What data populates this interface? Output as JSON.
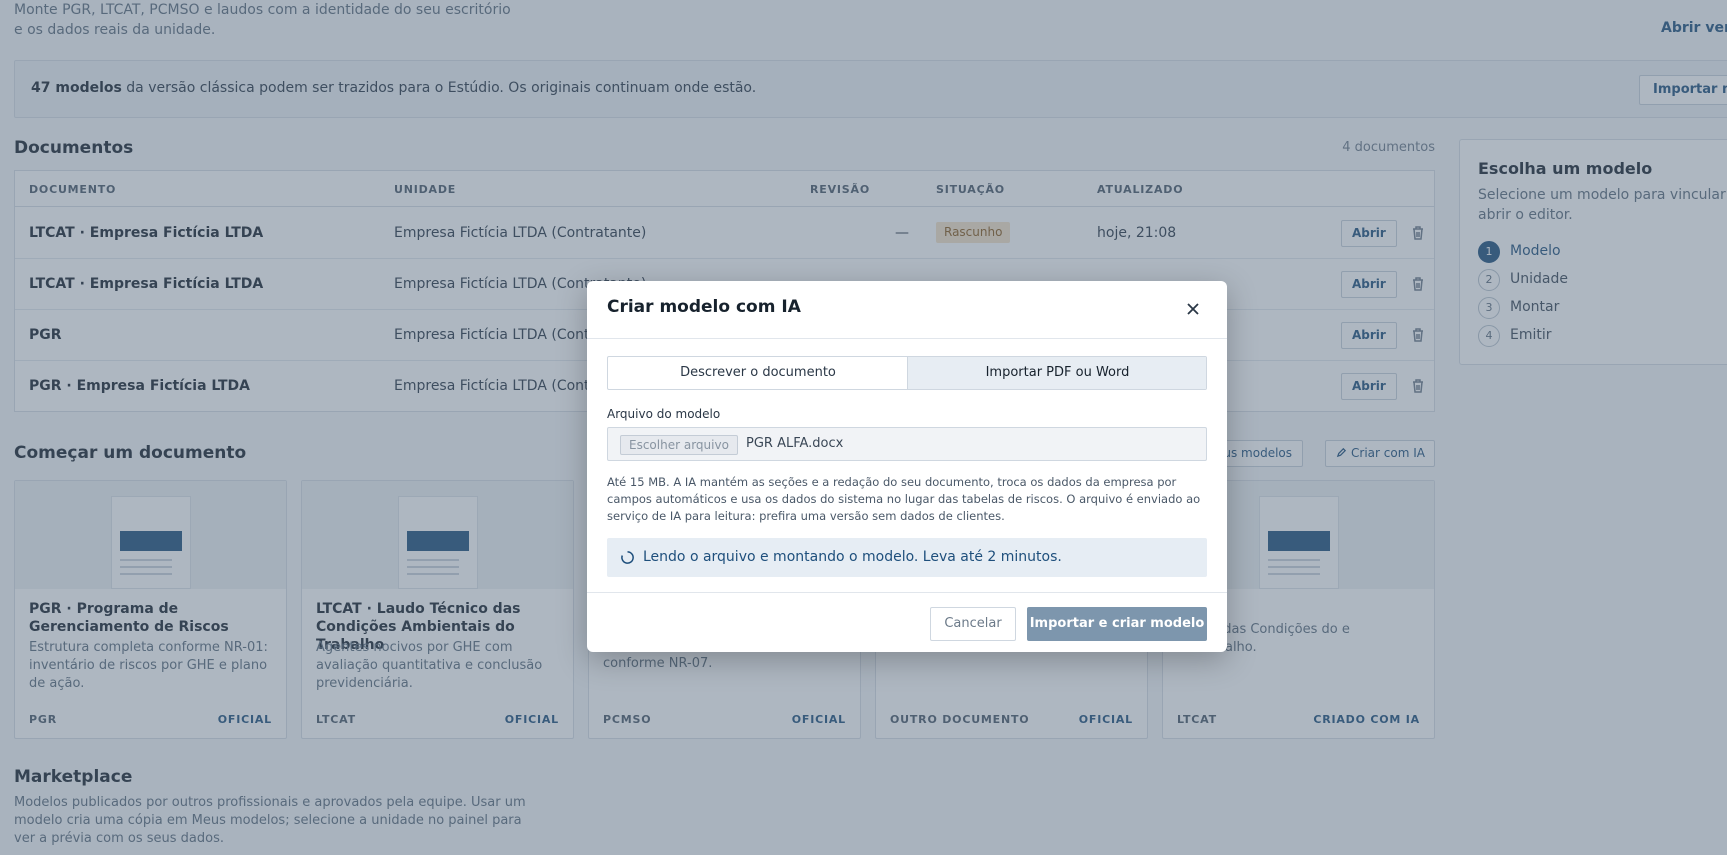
{
  "intro": {
    "text": "Monte PGR, LTCAT, PCMSO e laudos com a identidade do seu escritório e os dados reais da unidade.",
    "open_classic": "Abrir vers"
  },
  "banner": {
    "count_bold": "47 modelos",
    "text": " da versão clássica podem ser trazidos para o Estúdio. Os originais continuam onde estão.",
    "button": "Importar mo"
  },
  "documents": {
    "title": "Documentos",
    "count": "4 documentos",
    "columns": [
      "DOCUMENTO",
      "UNIDADE",
      "REVISÃO",
      "SITUAÇÃO",
      "ATUALIZADO"
    ],
    "open_label": "Abrir",
    "rows": [
      {
        "documento": "LTCAT · Empresa Fictícia LTDA",
        "unidade": "Empresa Fictícia LTDA (Contratante)",
        "revisao": "—",
        "situacao": "Rascunho",
        "atualizado": "hoje, 21:08"
      },
      {
        "documento": "LTCAT · Empresa Fictícia LTDA",
        "unidade": "Empresa Fictícia LTDA (Contratante)",
        "revisao": "",
        "situacao": "",
        "atualizado": ""
      },
      {
        "documento": "PGR",
        "unidade": "Empresa Fictícia LTDA (Contra",
        "revisao": "",
        "situacao": "",
        "atualizado": ""
      },
      {
        "documento": "PGR · Empresa Fictícia LTDA",
        "unidade": "Empresa Fictícia LTDA (Contra",
        "revisao": "",
        "situacao": "",
        "atualizado": ""
      }
    ]
  },
  "side_panel": {
    "title": "Escolha um modelo",
    "description": "Selecione um modelo para vincular a u e abrir o editor.",
    "steps": [
      {
        "num": "1",
        "label": "Modelo"
      },
      {
        "num": "2",
        "label": "Unidade"
      },
      {
        "num": "3",
        "label": "Montar"
      },
      {
        "num": "4",
        "label": "Emitir"
      }
    ]
  },
  "start": {
    "title": "Começar um documento",
    "my_models": "eus modelos",
    "create_ai": "Criar com IA",
    "cards": [
      {
        "title": "PGR · Programa de Gerenciamento de Riscos",
        "description": "Estrutura completa conforme NR-01: inventário de riscos por GHE e plano de ação.",
        "type": "PGR",
        "origin": "OFICIAL"
      },
      {
        "title": "LTCAT · Laudo Técnico das Condições Ambientais do Trabalho",
        "description": "Agentes nocivos por GHE com avaliação quantitativa e conclusão previdenciária.",
        "type": "LTCAT",
        "origin": "OFICIAL"
      },
      {
        "title": "",
        "description": "conforme NR-07.",
        "type": "PCMSO",
        "origin": "OFICIAL"
      },
      {
        "title": "",
        "description": "",
        "type": "OUTRO DOCUMENTO",
        "origin": "OFICIAL"
      },
      {
        "title": "",
        "description": "écnico das Condições do e de Trabalho.",
        "type": "LTCAT",
        "origin": "CRIADO COM IA"
      }
    ]
  },
  "marketplace": {
    "title": "Marketplace",
    "description": "Modelos publicados por outros profissionais e aprovados pela equipe. Usar um modelo cria uma cópia em Meus modelos; selecione a unidade no painel para ver a prévia com os seus dados."
  },
  "modal": {
    "title": "Criar modelo com IA",
    "tabs": [
      "Descrever o documento",
      "Importar PDF ou Word"
    ],
    "file_label": "Arquivo do modelo",
    "file_button": "Escolher arquivo",
    "file_name": "PGR ALFA.docx",
    "help": "Até 15 MB. A IA mantém as seções e a redação do seu documento, troca os dados da empresa por campos automáticos e usa os dados do sistema no lugar das tabelas de riscos. O arquivo é enviado ao serviço de IA para leitura: prefira uma versão sem dados de clientes.",
    "progress": "Lendo o arquivo e montando o modelo. Leva até 2 minutos.",
    "cancel": "Cancelar",
    "submit": "Importar e criar modelo"
  },
  "colors": {
    "accent": "#1e4f7c",
    "draft_badge_bg": "#f6e2c7",
    "primary_disabled": "#7d96ad"
  }
}
